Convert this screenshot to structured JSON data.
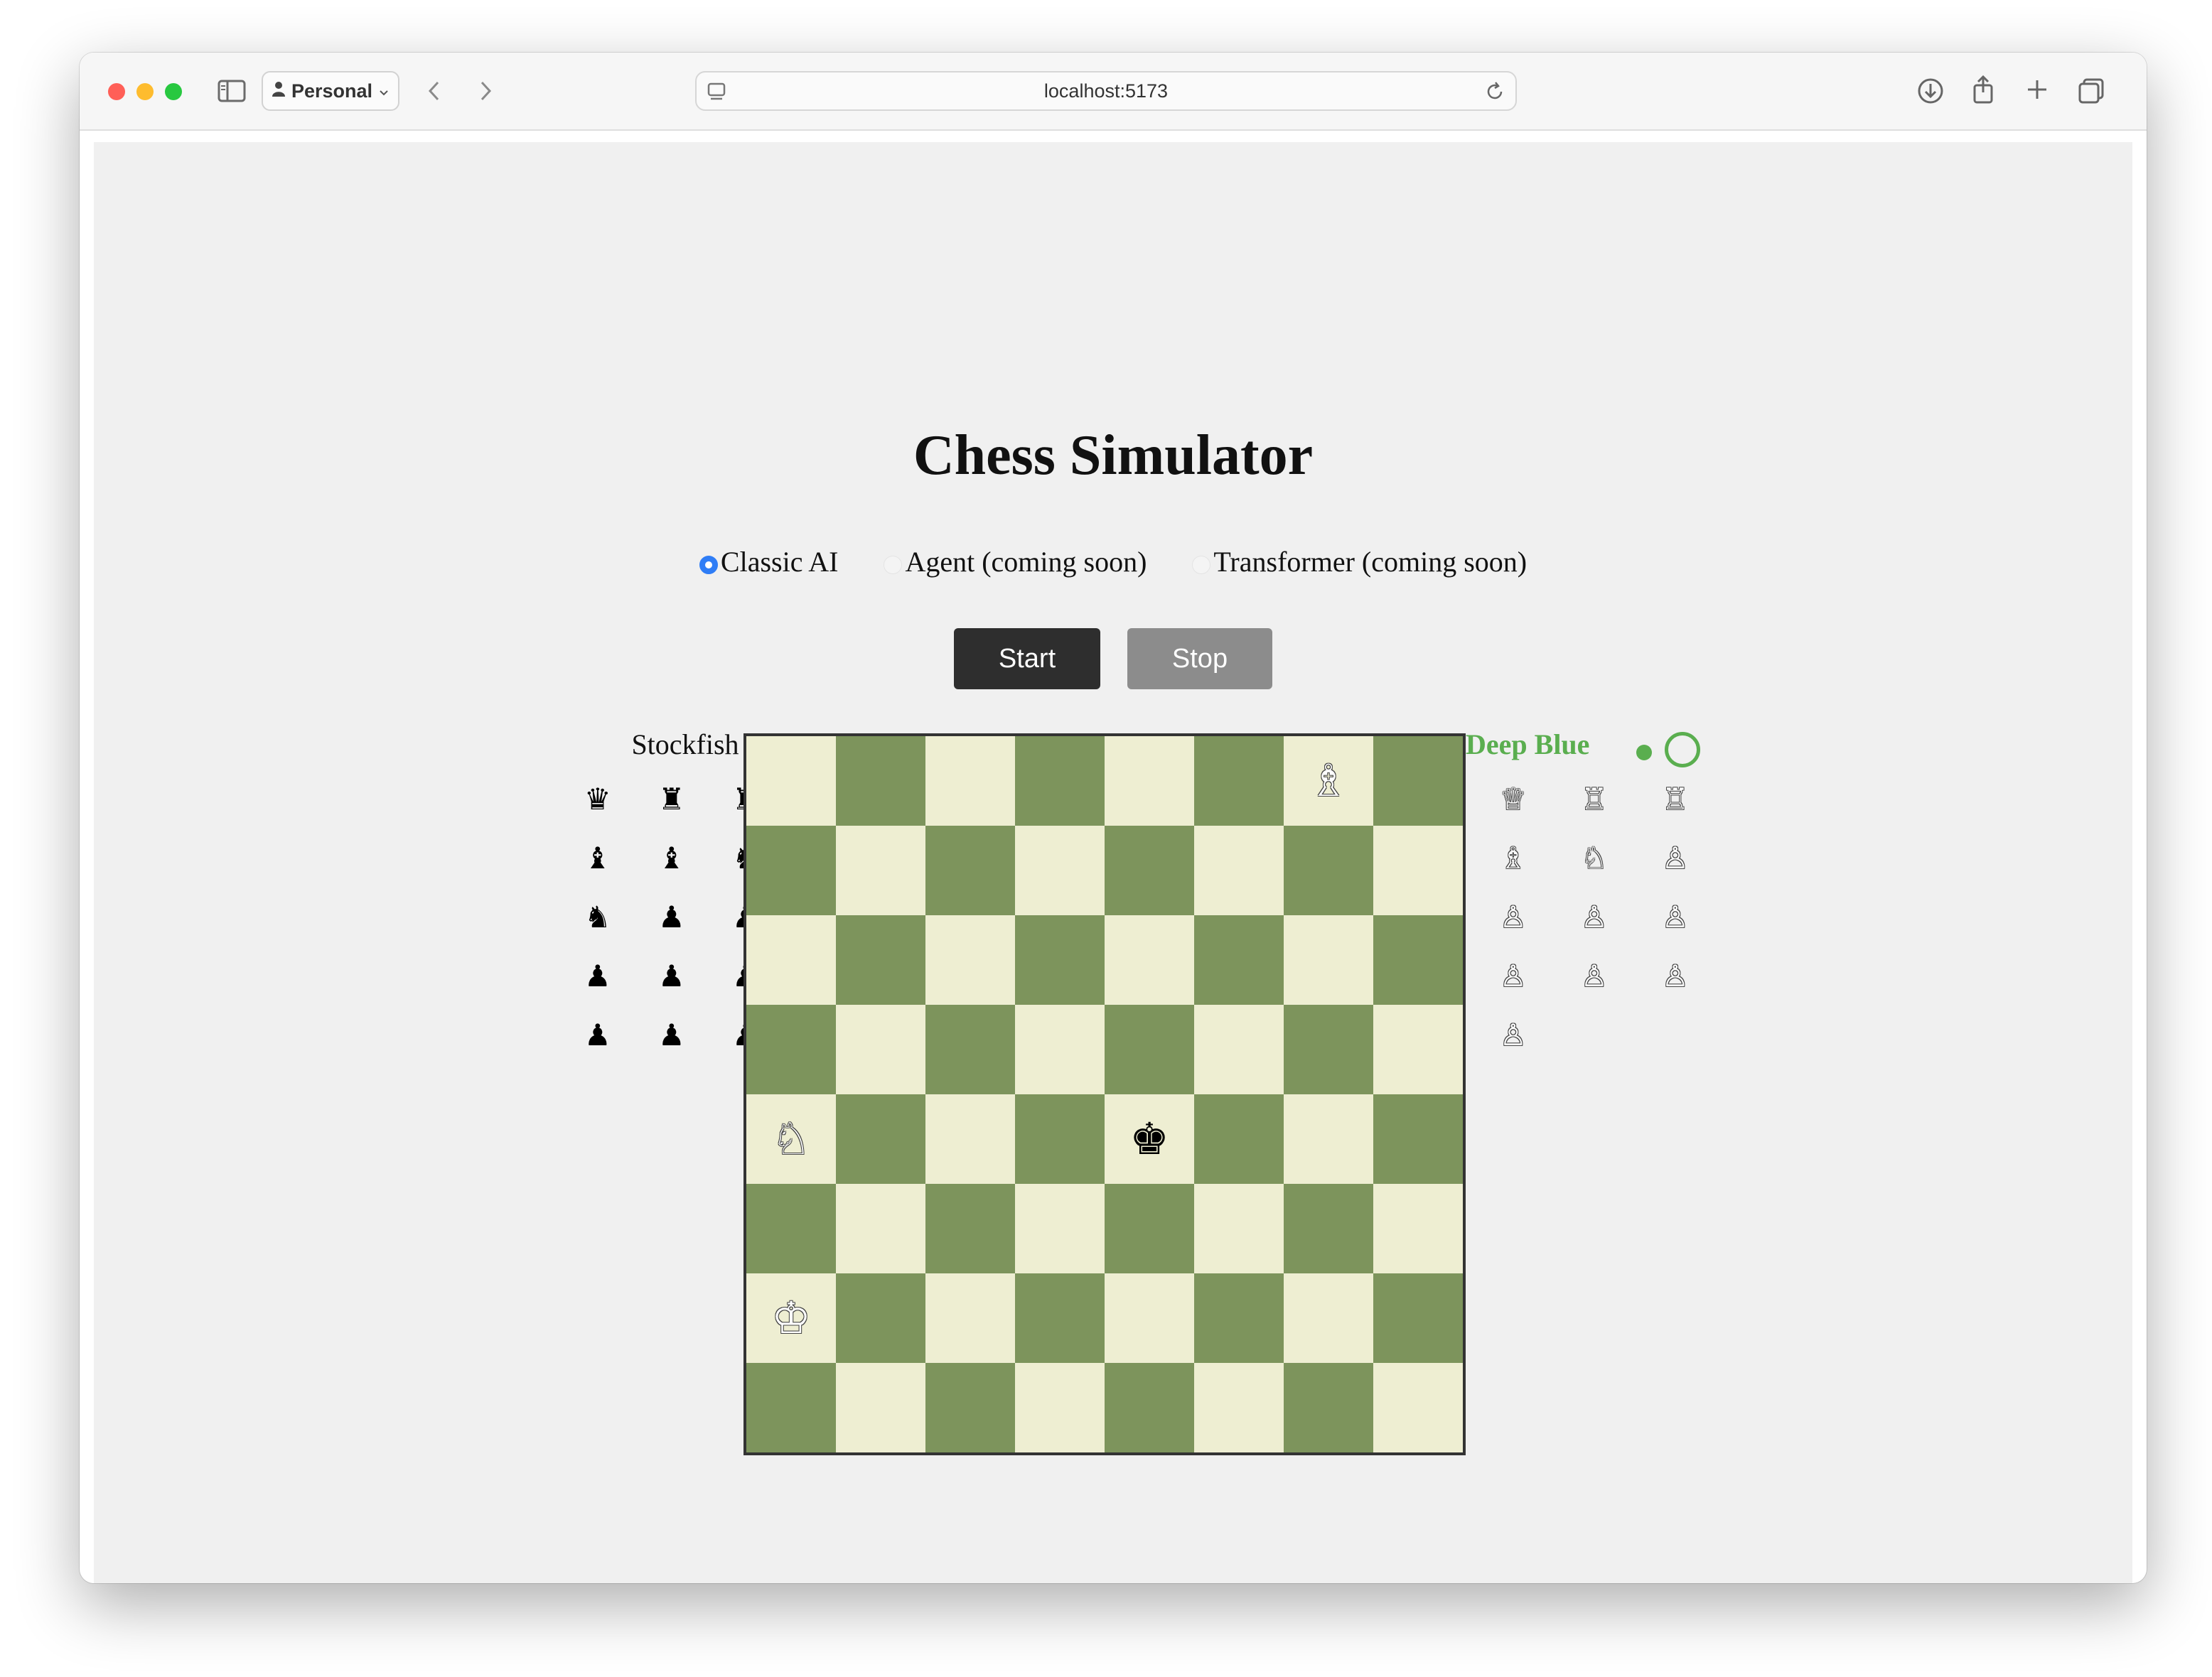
{
  "browser": {
    "profile_label": "Personal",
    "url": "localhost:5173"
  },
  "page": {
    "title": "Chess Simulator",
    "modes": [
      {
        "label": "Classic AI",
        "selected": true
      },
      {
        "label": "Agent (coming soon)",
        "selected": false
      },
      {
        "label": "Transformer (coming soon)",
        "selected": false
      }
    ],
    "start_label": "Start",
    "stop_label": "Stop"
  },
  "players": {
    "left": {
      "name": "Stockfish",
      "captured": [
        "♛",
        "♜",
        "♜",
        "♝",
        "♝",
        "♞",
        "♞",
        "♟",
        "♟",
        "♟",
        "♟",
        "♟",
        "♟",
        "♟",
        "♟"
      ]
    },
    "right": {
      "name": "Deep Blue",
      "active": true,
      "captured": [
        "♕",
        "♖",
        "♖",
        "♗",
        "♘",
        "♙",
        "♙",
        "♙",
        "♙",
        "♙",
        "♙",
        "♙",
        "♙"
      ]
    }
  },
  "board": {
    "rows": [
      [
        "",
        "",
        "",
        "",
        "",
        "",
        "♗",
        ""
      ],
      [
        "",
        "",
        "",
        "",
        "",
        "",
        "",
        ""
      ],
      [
        "",
        "",
        "",
        "",
        "",
        "",
        "",
        ""
      ],
      [
        "",
        "",
        "",
        "",
        "",
        "",
        "",
        ""
      ],
      [
        "♘",
        "",
        "",
        "",
        "♚",
        "",
        "",
        ""
      ],
      [
        "",
        "",
        "",
        "",
        "",
        "",
        "",
        ""
      ],
      [
        "♔",
        "",
        "",
        "",
        "",
        "",
        "",
        ""
      ],
      [
        "",
        "",
        "",
        "",
        "",
        "",
        "",
        ""
      ]
    ],
    "light_color": "#eeeed2",
    "dark_color": "#7d945c"
  },
  "colors": {
    "accent_green": "#5aae4f",
    "radio_blue": "#2f7df6"
  }
}
